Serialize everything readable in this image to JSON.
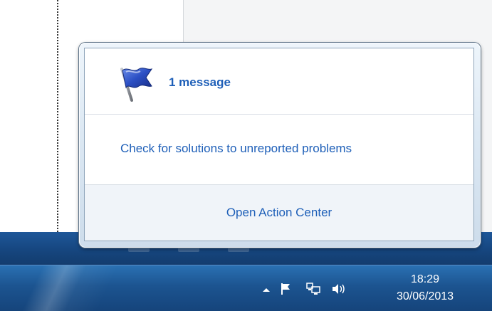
{
  "popup": {
    "message_title": "1 message",
    "flag_icon": "flag-icon",
    "solution_link": "Check for solutions to unreported problems",
    "open_action_center": "Open Action Center"
  },
  "taskbar": {
    "tray_icons": [
      "show-hidden-icons-arrow-icon",
      "action-center-flag-icon",
      "network-icon",
      "volume-icon"
    ],
    "clock_time": "18:29",
    "clock_date": "30/06/2013"
  },
  "colors": {
    "link": "#1e5fb8",
    "taskbar": "#1c5490",
    "popup_footer": "#f0f4f9"
  }
}
